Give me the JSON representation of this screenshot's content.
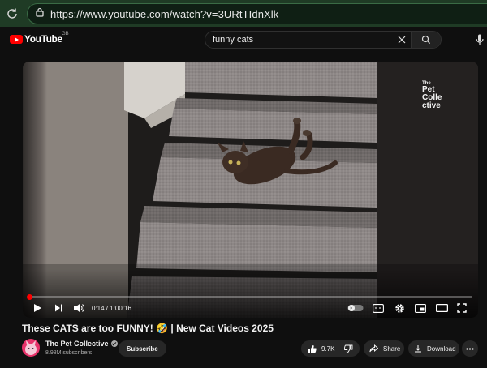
{
  "browser": {
    "url": "https://www.youtube.com/watch?v=3URtTIdnXlk"
  },
  "header": {
    "logo_text": "YouTube",
    "country": "GB",
    "search_value": "funny cats"
  },
  "player": {
    "time_display": "0:14 / 1:00:16",
    "progress": 0.004,
    "overlay_brand": [
      "The",
      "Pet",
      "Colle",
      "ctive"
    ]
  },
  "video": {
    "title": "These CATS are too FUNNY! 🤣 | New Cat Videos 2025"
  },
  "channel": {
    "name": "The Pet Collective",
    "subscribers": "8.98M subscribers",
    "subscribe_label": "Subscribe"
  },
  "actions": {
    "like_count": "9.7K",
    "share_label": "Share",
    "download_label": "Download"
  },
  "colors": {
    "accent": "#ff0000",
    "browser_bar": "#1f3b25"
  }
}
